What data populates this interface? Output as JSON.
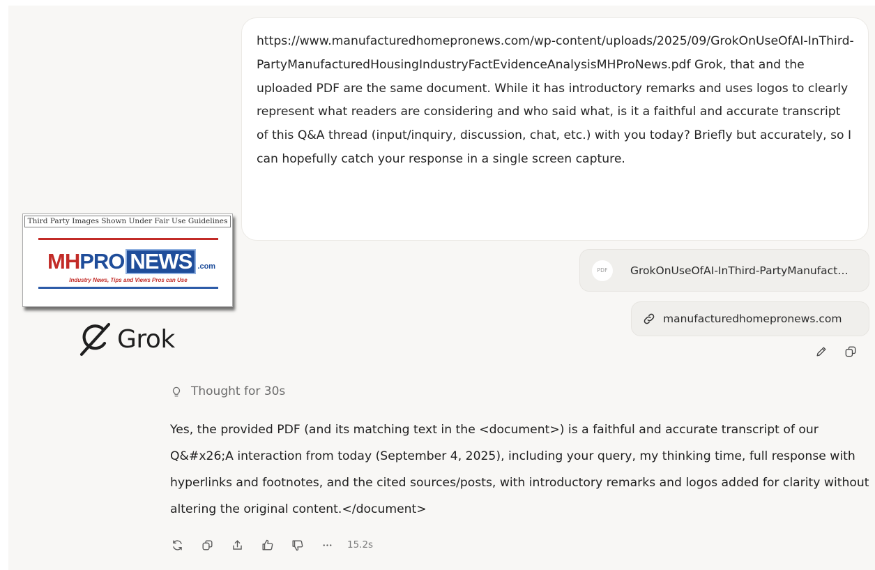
{
  "user_message": {
    "text": "https://www.manufacturedhomepronews.com/wp-content/uploads/2025/09/GrokOnUseOfAI-InThird-PartyManufacturedHousingIndustryFactEvidenceAnalysisMHProNews.pdf Grok, that and the uploaded PDF are the same document. While it has introductory remarks and uses logos to clearly represent what readers are considering and who said what, is it a faithful and accurate transcript of this Q&A thread (input/inquiry, discussion, chat, etc.) with you today? Briefly but accurately, so I can hopefully catch your response in a single screen capture."
  },
  "attachments": {
    "pdf": {
      "icon_label": "PDF",
      "filename": "GrokOnUseOfAI-InThird-PartyManufacturedHousingIndustryFactEvidenceAnalysisMHProNews.pdf"
    },
    "link": {
      "domain": "manufacturedhomepronews.com",
      "icon": "link-icon"
    }
  },
  "message_actions": [
    "pencil-icon",
    "copy-icon"
  ],
  "logo": {
    "caption": "Third Party Images Shown Under Fair Use Guidelines",
    "word_mh": "MH",
    "word_pro": "PRO",
    "word_news": "NEWS",
    "word_com": ".com",
    "tagline": "Industry News, Tips and Views Pros can Use",
    "colors": {
      "red": "#c22b27",
      "blue": "#1f4d9a"
    }
  },
  "brand": {
    "name": "Grok",
    "icon": "grok-icon"
  },
  "thought": {
    "label": "Thought for 30s",
    "icon": "lightbulb-icon"
  },
  "response": {
    "text": "Yes, the provided PDF (and its matching text in the <document>) is a faithful and accurate transcript of our Q&#x26;A interaction from today (September 4, 2025), including your query, my thinking time, full response with hyperlinks and footnotes, and the cited sources/posts, with introductory remarks and logos added for clarity without altering the original content.</document>"
  },
  "toolbar": {
    "icons": [
      "regenerate-icon",
      "copy-icon",
      "share-icon",
      "thumbs-up-icon",
      "thumbs-down-icon",
      "more-icon"
    ],
    "timing": "15.2s"
  }
}
